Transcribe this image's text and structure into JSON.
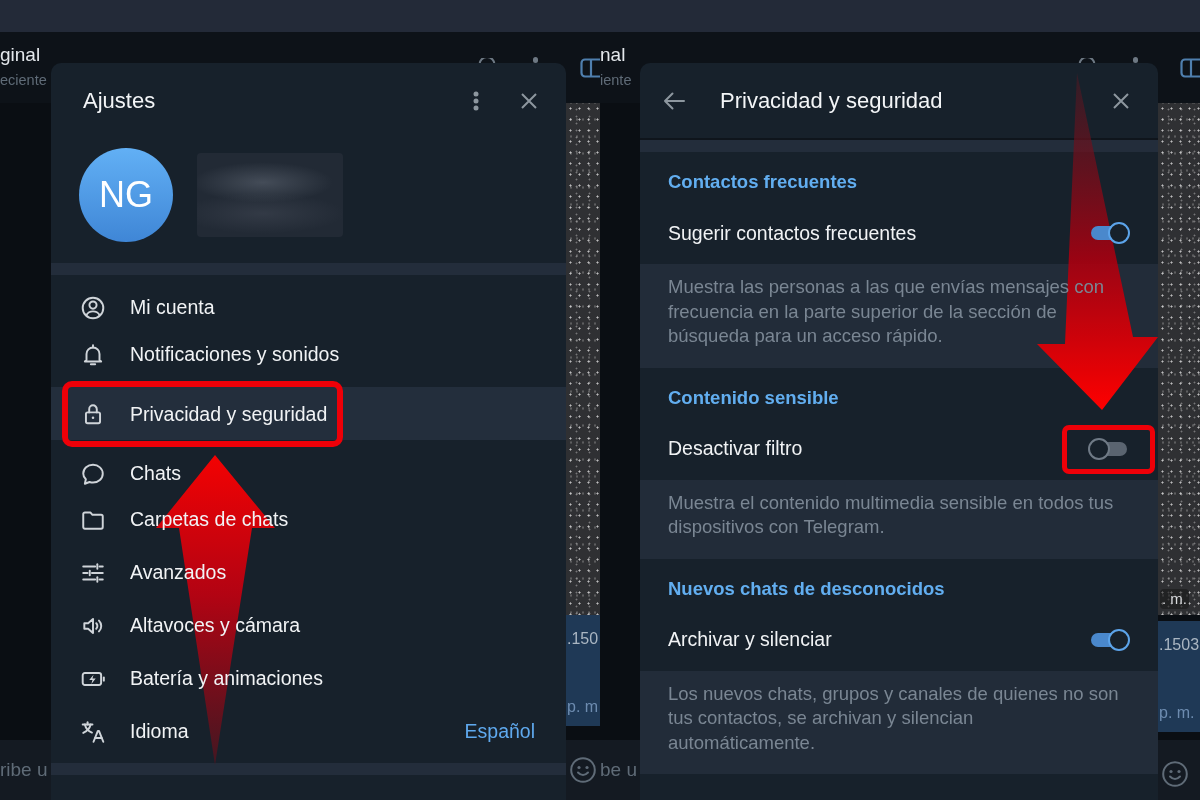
{
  "screens": [
    {
      "kind": "settings",
      "chat": {
        "title": "ginal",
        "status": "eciente",
        "bubble_text": ".150",
        "bubble_time": "p. m",
        "composer_placeholder": "ribe u"
      },
      "dialog": {
        "title": "Ajustes",
        "profile": {
          "initials": "NG"
        },
        "items": [
          {
            "label": "Mi cuenta",
            "selected": false,
            "highlighted": false
          },
          {
            "label": "Notificaciones y sonidos",
            "selected": false,
            "highlighted": false
          },
          {
            "label": "Privacidad y seguridad",
            "selected": true,
            "highlighted": true
          },
          {
            "label": "Chats",
            "selected": false,
            "highlighted": false
          },
          {
            "label": "Carpetas de chats",
            "selected": false,
            "highlighted": false
          },
          {
            "label": "Avanzados",
            "selected": false,
            "highlighted": false
          },
          {
            "label": "Altavoces y cámara",
            "selected": false,
            "highlighted": false
          },
          {
            "label": "Batería y animaciones",
            "selected": false,
            "highlighted": false
          },
          {
            "label": "Idioma",
            "value": "Español",
            "selected": false,
            "highlighted": false
          }
        ]
      }
    },
    {
      "kind": "privacy",
      "chat": {
        "title": "nal",
        "status": "iente",
        "photo_time": ". m.",
        "bubble_text": ".1503",
        "bubble_time": "p. m.",
        "composer_placeholder": "be u"
      },
      "dialog": {
        "title": "Privacidad y seguridad",
        "sections": [
          {
            "heading": "Contactos frecuentes",
            "setting": {
              "label": "Sugerir contactos frecuentes",
              "on": true,
              "highlighted": false
            },
            "description": "Muestra las personas a las que envías mensajes con frecuencia en la parte superior de la sección de búsqueda para un acceso rápido."
          },
          {
            "heading": "Contenido sensible",
            "setting": {
              "label": "Desactivar filtro",
              "on": false,
              "highlighted": true
            },
            "description": "Muestra el contenido multimedia sensible en todos tus dispositivos con Telegram."
          },
          {
            "heading": "Nuevos chats de desconocidos",
            "setting": {
              "label": "Archivar y silenciar",
              "on": true,
              "highlighted": false
            },
            "description": "Los nuevos chats, grupos y canales de quienes no son tus contactos, se archivan y silencian automáticamente."
          }
        ]
      }
    }
  ]
}
